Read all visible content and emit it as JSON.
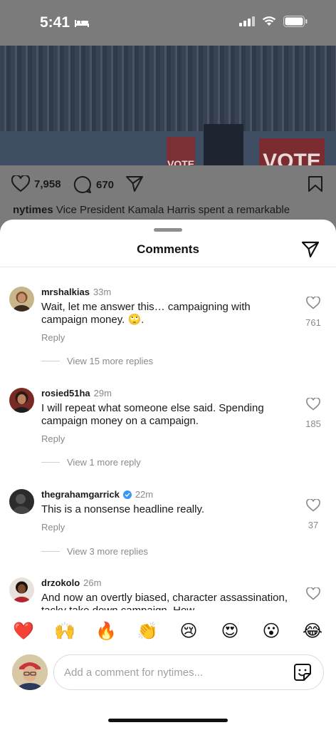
{
  "status_bar": {
    "time": "5:41"
  },
  "post": {
    "sign_left": "VOTE",
    "sign_right": "VOTE",
    "likes": "7,958",
    "comments": "670",
    "caption_user": "nytimes",
    "caption_text": "Vice President Kamala Harris spent a remarkable"
  },
  "sheet": {
    "title": "Comments"
  },
  "comments": [
    {
      "user": "mrshalkias",
      "time": "33m",
      "text": "Wait, let me answer this… campaigning with campaign money. 🙄.",
      "reply_label": "Reply",
      "more_replies": "View 15 more replies",
      "likes": "761"
    },
    {
      "user": "rosied51ha",
      "time": "29m",
      "text": "I will repeat what someone else said.  Spending campaign money on a campaign.",
      "reply_label": "Reply",
      "more_replies": "View 1 more reply",
      "likes": "185"
    },
    {
      "user": "thegrahamgarrick",
      "time": "22m",
      "text": "This is a nonsense headline really.",
      "reply_label": "Reply",
      "more_replies": "View 3 more replies",
      "likes": "37"
    },
    {
      "user": "drzokolo",
      "time": "26m",
      "text": "And now an overtly biased, character assassination, tacky take down campaign. How",
      "likes": ""
    }
  ],
  "emoji_bar": [
    "❤️",
    "🙌",
    "🔥",
    "👏",
    "😢",
    "😍",
    "😮",
    "😂"
  ],
  "composer": {
    "placeholder": "Add a comment for nytimes..."
  }
}
